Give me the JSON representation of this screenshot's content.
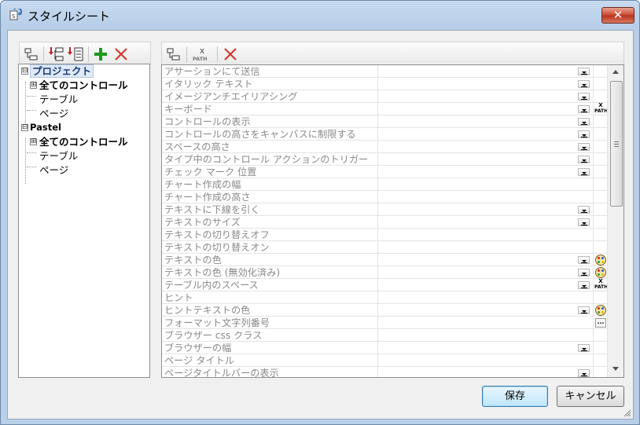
{
  "window": {
    "title": "スタイルシート"
  },
  "left_tree": [
    {
      "label": "プロジェクト",
      "selected": true
    },
    {
      "label": "全てのコントロール"
    },
    {
      "label": "テーブル"
    },
    {
      "label": "ページ"
    },
    {
      "label": "Pastel"
    },
    {
      "label": "全てのコントロール"
    },
    {
      "label": "テーブル"
    },
    {
      "label": "ページ"
    }
  ],
  "tree_toggles": {
    "collapse": "⊟",
    "expand": "⊞"
  },
  "xpath_text": {
    "top": "X",
    "bottom": "PATH"
  },
  "ellipsis_text": "...",
  "properties": [
    {
      "name": "アサーションにて送信",
      "dropdown": true,
      "extra": ""
    },
    {
      "name": "イタリック テキスト",
      "dropdown": true,
      "extra": ""
    },
    {
      "name": "イメージアンチエイリアシング",
      "dropdown": true,
      "extra": ""
    },
    {
      "name": "キーボード",
      "dropdown": true,
      "extra": "xpath"
    },
    {
      "name": "コントロールの表示",
      "dropdown": true,
      "extra": ""
    },
    {
      "name": "コントロールの高さをキャンバスに制限する",
      "dropdown": true,
      "extra": ""
    },
    {
      "name": "スペースの高さ",
      "dropdown": true,
      "extra": ""
    },
    {
      "name": "タイプ中のコントロール アクションのトリガー",
      "dropdown": true,
      "extra": ""
    },
    {
      "name": "チェック マーク 位置",
      "dropdown": true,
      "extra": ""
    },
    {
      "name": "チャート作成の幅",
      "dropdown": false,
      "extra": ""
    },
    {
      "name": "チャート作成の高さ",
      "dropdown": false,
      "extra": ""
    },
    {
      "name": "テキストに下線を引く",
      "dropdown": true,
      "extra": ""
    },
    {
      "name": "テキストのサイズ",
      "dropdown": true,
      "extra": ""
    },
    {
      "name": "テキストの切り替えオフ",
      "dropdown": false,
      "extra": ""
    },
    {
      "name": "テキストの切り替えオン",
      "dropdown": false,
      "extra": ""
    },
    {
      "name": "テキストの色",
      "dropdown": true,
      "extra": "palette"
    },
    {
      "name": "テキストの色 (無効化済み)",
      "dropdown": true,
      "extra": "palette"
    },
    {
      "name": "テーブル内のスペース",
      "dropdown": true,
      "extra": "xpath"
    },
    {
      "name": "ヒント",
      "dropdown": false,
      "extra": ""
    },
    {
      "name": "ヒントテキストの色",
      "dropdown": true,
      "extra": "palette"
    },
    {
      "name": "フォーマット文字列番号",
      "dropdown": false,
      "extra": "ellipsis"
    },
    {
      "name": "ブラウザー css クラス",
      "dropdown": false,
      "extra": ""
    },
    {
      "name": "ブラウザーの幅",
      "dropdown": true,
      "extra": ""
    },
    {
      "name": "ページ タイトル",
      "dropdown": false,
      "extra": ""
    },
    {
      "name": "ページタイトルバーの表示",
      "dropdown": true,
      "extra": ""
    }
  ],
  "buttons": {
    "save": "保存",
    "cancel": "キャンセル"
  },
  "colors": {
    "add": "#1a9a1a",
    "delete": "#d33a2c",
    "accent": "#3c7fb1"
  }
}
